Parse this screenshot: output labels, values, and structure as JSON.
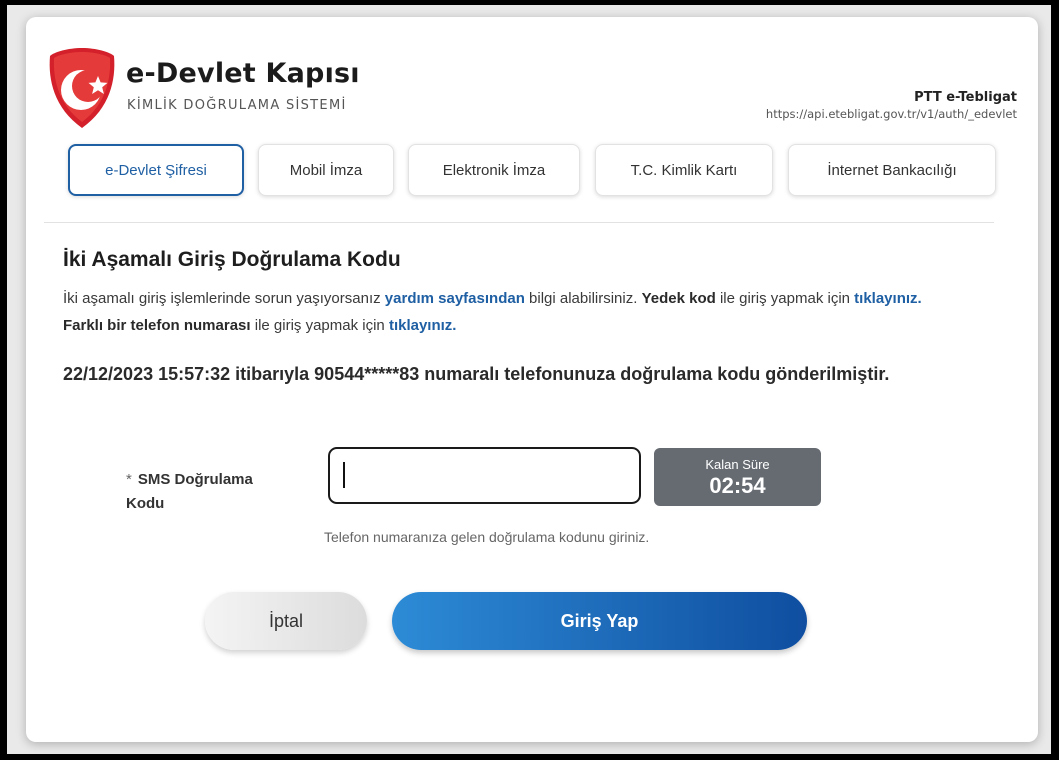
{
  "header": {
    "title": "e-Devlet Kapısı",
    "subtitle": "KİMLİK DOĞRULAMA SİSTEMİ",
    "service_name": "PTT e-Tebligat",
    "service_url": "https://api.etebligat.gov.tr/v1/auth/_edevlet"
  },
  "tabs": [
    {
      "label": "e-Devlet Şifresi",
      "active": true
    },
    {
      "label": "Mobil İmza",
      "active": false
    },
    {
      "label": "Elektronik İmza",
      "active": false
    },
    {
      "label": "T.C. Kimlik Kartı",
      "active": false
    },
    {
      "label": "İnternet Bankacılığı",
      "active": false
    }
  ],
  "main": {
    "heading": "İki Aşamalı Giriş Doğrulama Kodu",
    "info": {
      "t1": "İki aşamalı giriş işlemlerinde sorun yaşıyorsanız ",
      "link1": "yardım sayfasından",
      "t2": " bilgi alabilirsiniz. ",
      "b1": "Yedek kod",
      "t3": " ile giriş yapmak için ",
      "link2": "tıklayınız.",
      "t4": " ",
      "b2": "Farklı bir telefon numarası",
      "t5": " ile giriş yapmak için ",
      "link3": "tıklayınız."
    },
    "notice": "22/12/2023 15:57:32 itibarıyla 90544*****83 numaralı telefonunuza doğrulama kodu gönderilmiştir."
  },
  "form": {
    "required_mark": "*",
    "label": "SMS Doğrulama Kodu",
    "value": "",
    "timer_label": "Kalan Süre",
    "timer_value": "02:54",
    "hint": "Telefon numaranıza gelen doğrulama kodunu giriniz."
  },
  "buttons": {
    "cancel": "İptal",
    "login": "Giriş Yap"
  },
  "colors": {
    "accent": "#1f5fa3",
    "logo_red": "#d3202a",
    "timer_bg": "#666b72"
  },
  "icons": {
    "logo": "crescent-star-shield-icon"
  }
}
